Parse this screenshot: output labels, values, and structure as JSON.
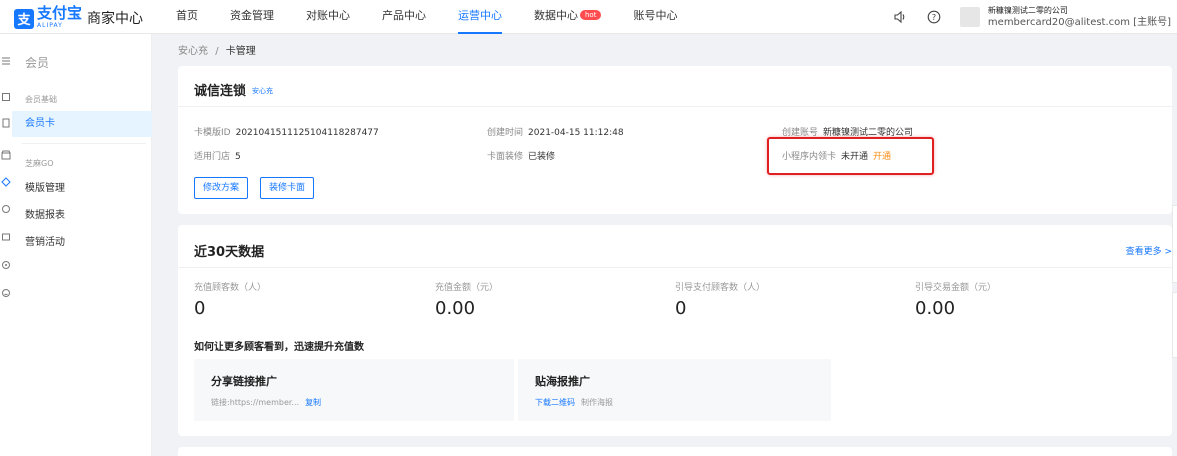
{
  "brand": {
    "logo_mark": "支",
    "logo_cn": "支付宝",
    "logo_en": "ALIPAY",
    "title": "商家中心"
  },
  "nav": {
    "items": [
      {
        "label": "首页"
      },
      {
        "label": "资金管理"
      },
      {
        "label": "对账中心"
      },
      {
        "label": "产品中心"
      },
      {
        "label": "运营中心",
        "active": true
      },
      {
        "label": "数据中心",
        "badge": "hot"
      },
      {
        "label": "账号中心"
      }
    ]
  },
  "account": {
    "name": "新糠镍测试二零的公司",
    "email": "membercard20@alitest.com [主账号]",
    "sound_icon": "speaker-icon",
    "help_icon": "help-circle-icon",
    "help_glyph": "?"
  },
  "sidebar": {
    "title": "会员",
    "group1": "会员基础",
    "item_card": "会员卡",
    "group2": "芝麻GO",
    "item_template": "模版管理",
    "item_report": "数据报表",
    "item_marketing": "营销活动"
  },
  "breadcrumb": {
    "parent": "安心充",
    "sep": "/",
    "current": "卡管理"
  },
  "card_info": {
    "title": "诚信连锁",
    "tag": "安心充",
    "template_id_label": "卡模版ID",
    "template_id_value": "20210415111251041182874​77",
    "stores_label": "适用门店",
    "stores_value": "5",
    "created_time_label": "创建时间",
    "created_time_value": "2021-04-15 11:12:48",
    "decoration_label": "卡面装修",
    "decoration_value": "已装修",
    "created_account_label": "创建账号",
    "created_account_value": "新糠镍测试二零的公司",
    "mini_program_label": "小程序内领卡",
    "mini_program_value": "未开通",
    "mini_program_action": "开通",
    "btn_modify": "修改方案",
    "btn_decorate": "装修卡面"
  },
  "stats": {
    "title": "近30天数据",
    "more": "查看更多 >",
    "metrics": [
      {
        "label": "充值顾客数（人）",
        "value": "0"
      },
      {
        "label": "充值金额（元）",
        "value": "0.00"
      },
      {
        "label": "引导支付顾客数（人）",
        "value": "0"
      },
      {
        "label": "引导交易金额（元）",
        "value": "0.00"
      }
    ],
    "promo_heading": "如何让更多顾客看到，迅速提升充值数",
    "share": {
      "title": "分享链接推广",
      "link_text": "链接:https://member...",
      "copy": "复制"
    },
    "poster": {
      "title": "贴海报推广",
      "download": "下载二维码",
      "make": "制作海报"
    }
  }
}
